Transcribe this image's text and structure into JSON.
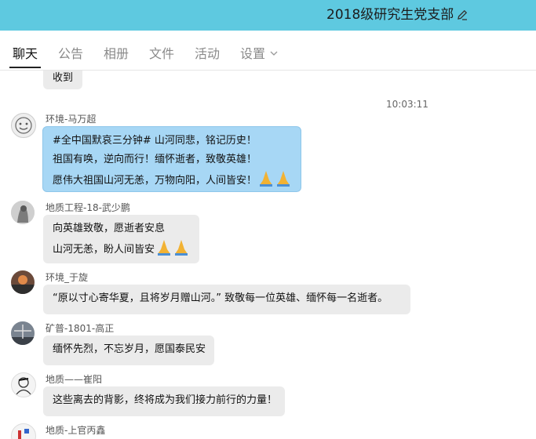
{
  "header": {
    "group_title": "2018级研究生党支部",
    "edit_icon": "pencil-icon"
  },
  "tabs": [
    {
      "label": "聊天",
      "active": true
    },
    {
      "label": "公告",
      "active": false
    },
    {
      "label": "相册",
      "active": false
    },
    {
      "label": "文件",
      "active": false
    },
    {
      "label": "活动",
      "active": false
    },
    {
      "label": "设置",
      "active": false
    }
  ],
  "messages": {
    "prev_bubble": "收到",
    "timestamp": "10:03:11",
    "m1": {
      "sender": "环境-马万超",
      "lines": [
        "#全中国默哀三分钟# 山河同悲，铭记历史！",
        "祖国有唤，逆向而行！缅怀逝者，致敬英雄！",
        "愿伟大祖国山河无恙，万物向阳，人间皆安！"
      ],
      "emoji": "folded-hands-icon"
    },
    "m2": {
      "sender": "地质工程-18-武少鹏",
      "lines": [
        "向英雄致敬，愿逝者安息",
        "山河无恙，盼人间皆安"
      ],
      "emoji": "folded-hands-icon"
    },
    "m3": {
      "sender": "环境_于旋",
      "text": "“原以寸心寄华夏，且将岁月赠山河。”  致敬每一位英雄、缅怀每一名逝者。"
    },
    "m4": {
      "sender": "矿普-1801-高正",
      "text": "缅怀先烈，不忘岁月，愿国泰民安"
    },
    "m5": {
      "sender": "地质——崔阳",
      "text": "这些离去的背影，终将成为我们接力前行的力量！"
    },
    "m6": {
      "sender": "地质-上官丙鑫"
    }
  },
  "colors": {
    "titlebar": "#5ec9e0",
    "self_bubble": "#a7d7f5",
    "other_bubble": "#ebebeb"
  }
}
